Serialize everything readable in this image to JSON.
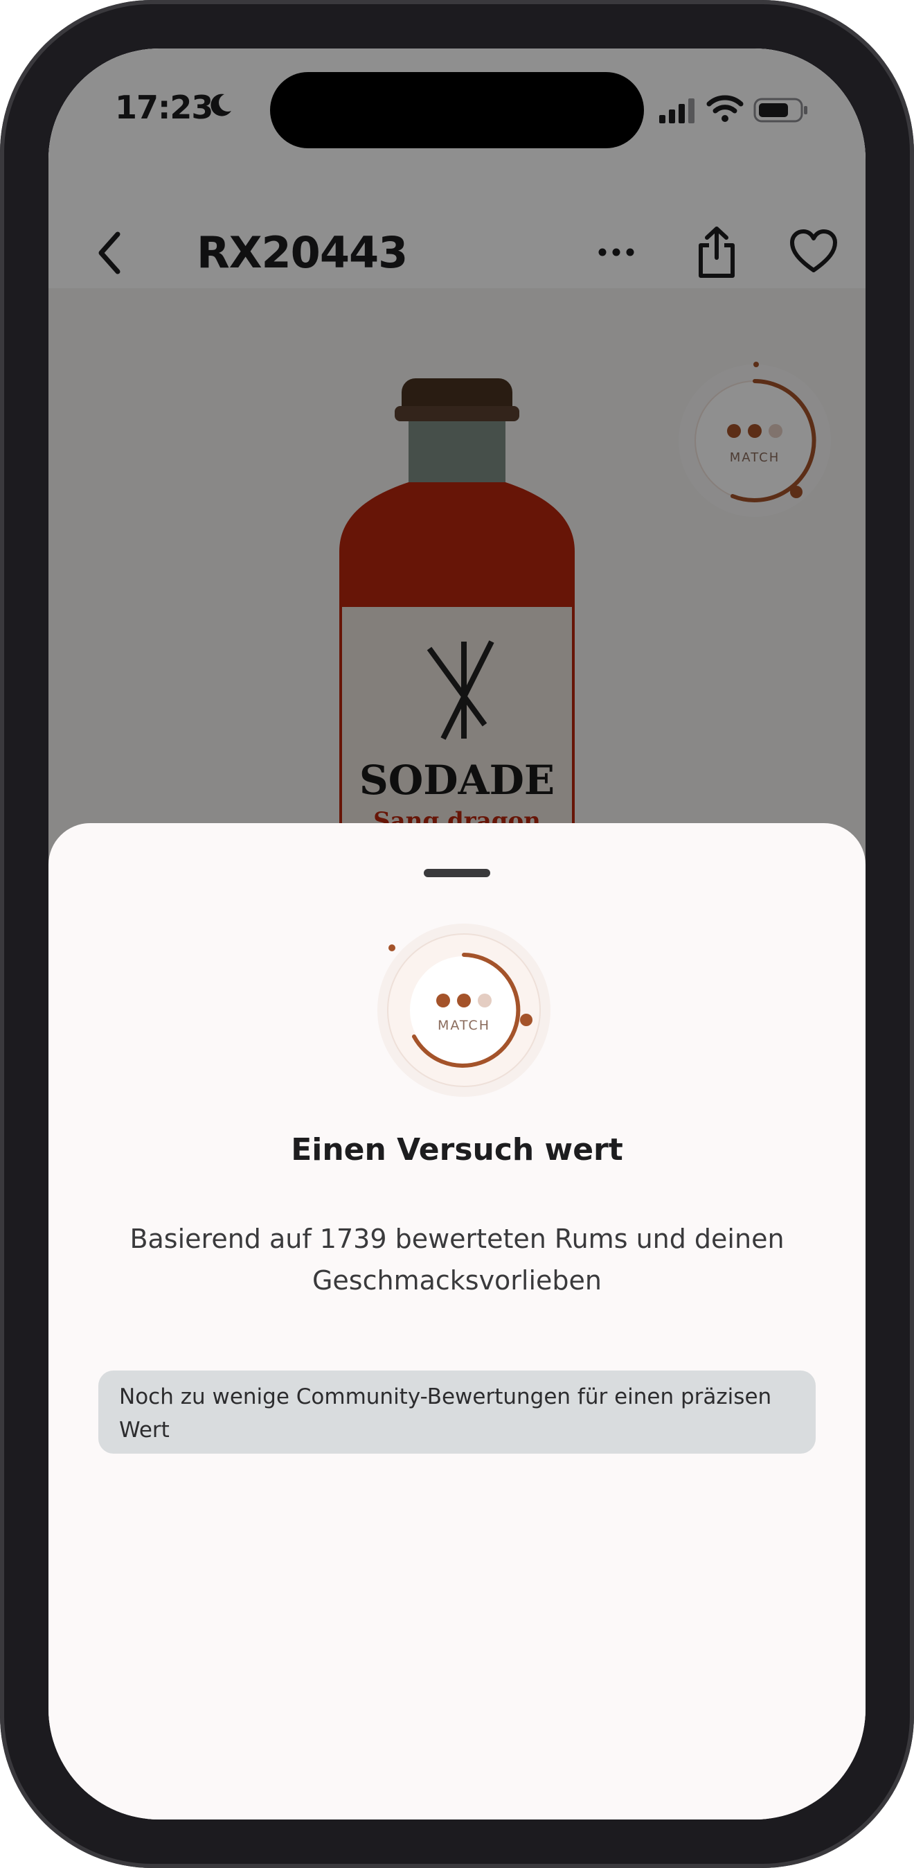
{
  "status_bar": {
    "time": "17:23"
  },
  "nav": {
    "title": "RX20443"
  },
  "product_image": {
    "label_brand": "SODADE",
    "label_subtitle": "Sang dragon"
  },
  "match_badge": {
    "label": "MATCH",
    "level": 2,
    "max_level": 3
  },
  "sheet": {
    "title": "Einen Versuch wert",
    "subtitle": "Basierend auf 1739 bewerteten Rums und deinen Geschmacksvorlieben",
    "info": "Noch zu wenige Community-Bewertungen für einen präzisen Wert"
  },
  "colors": {
    "accent": "#a4532a",
    "accent_light": "#e4cdc2",
    "sheet_bg": "#fcf9f9",
    "info_bg": "#d9dcde"
  }
}
